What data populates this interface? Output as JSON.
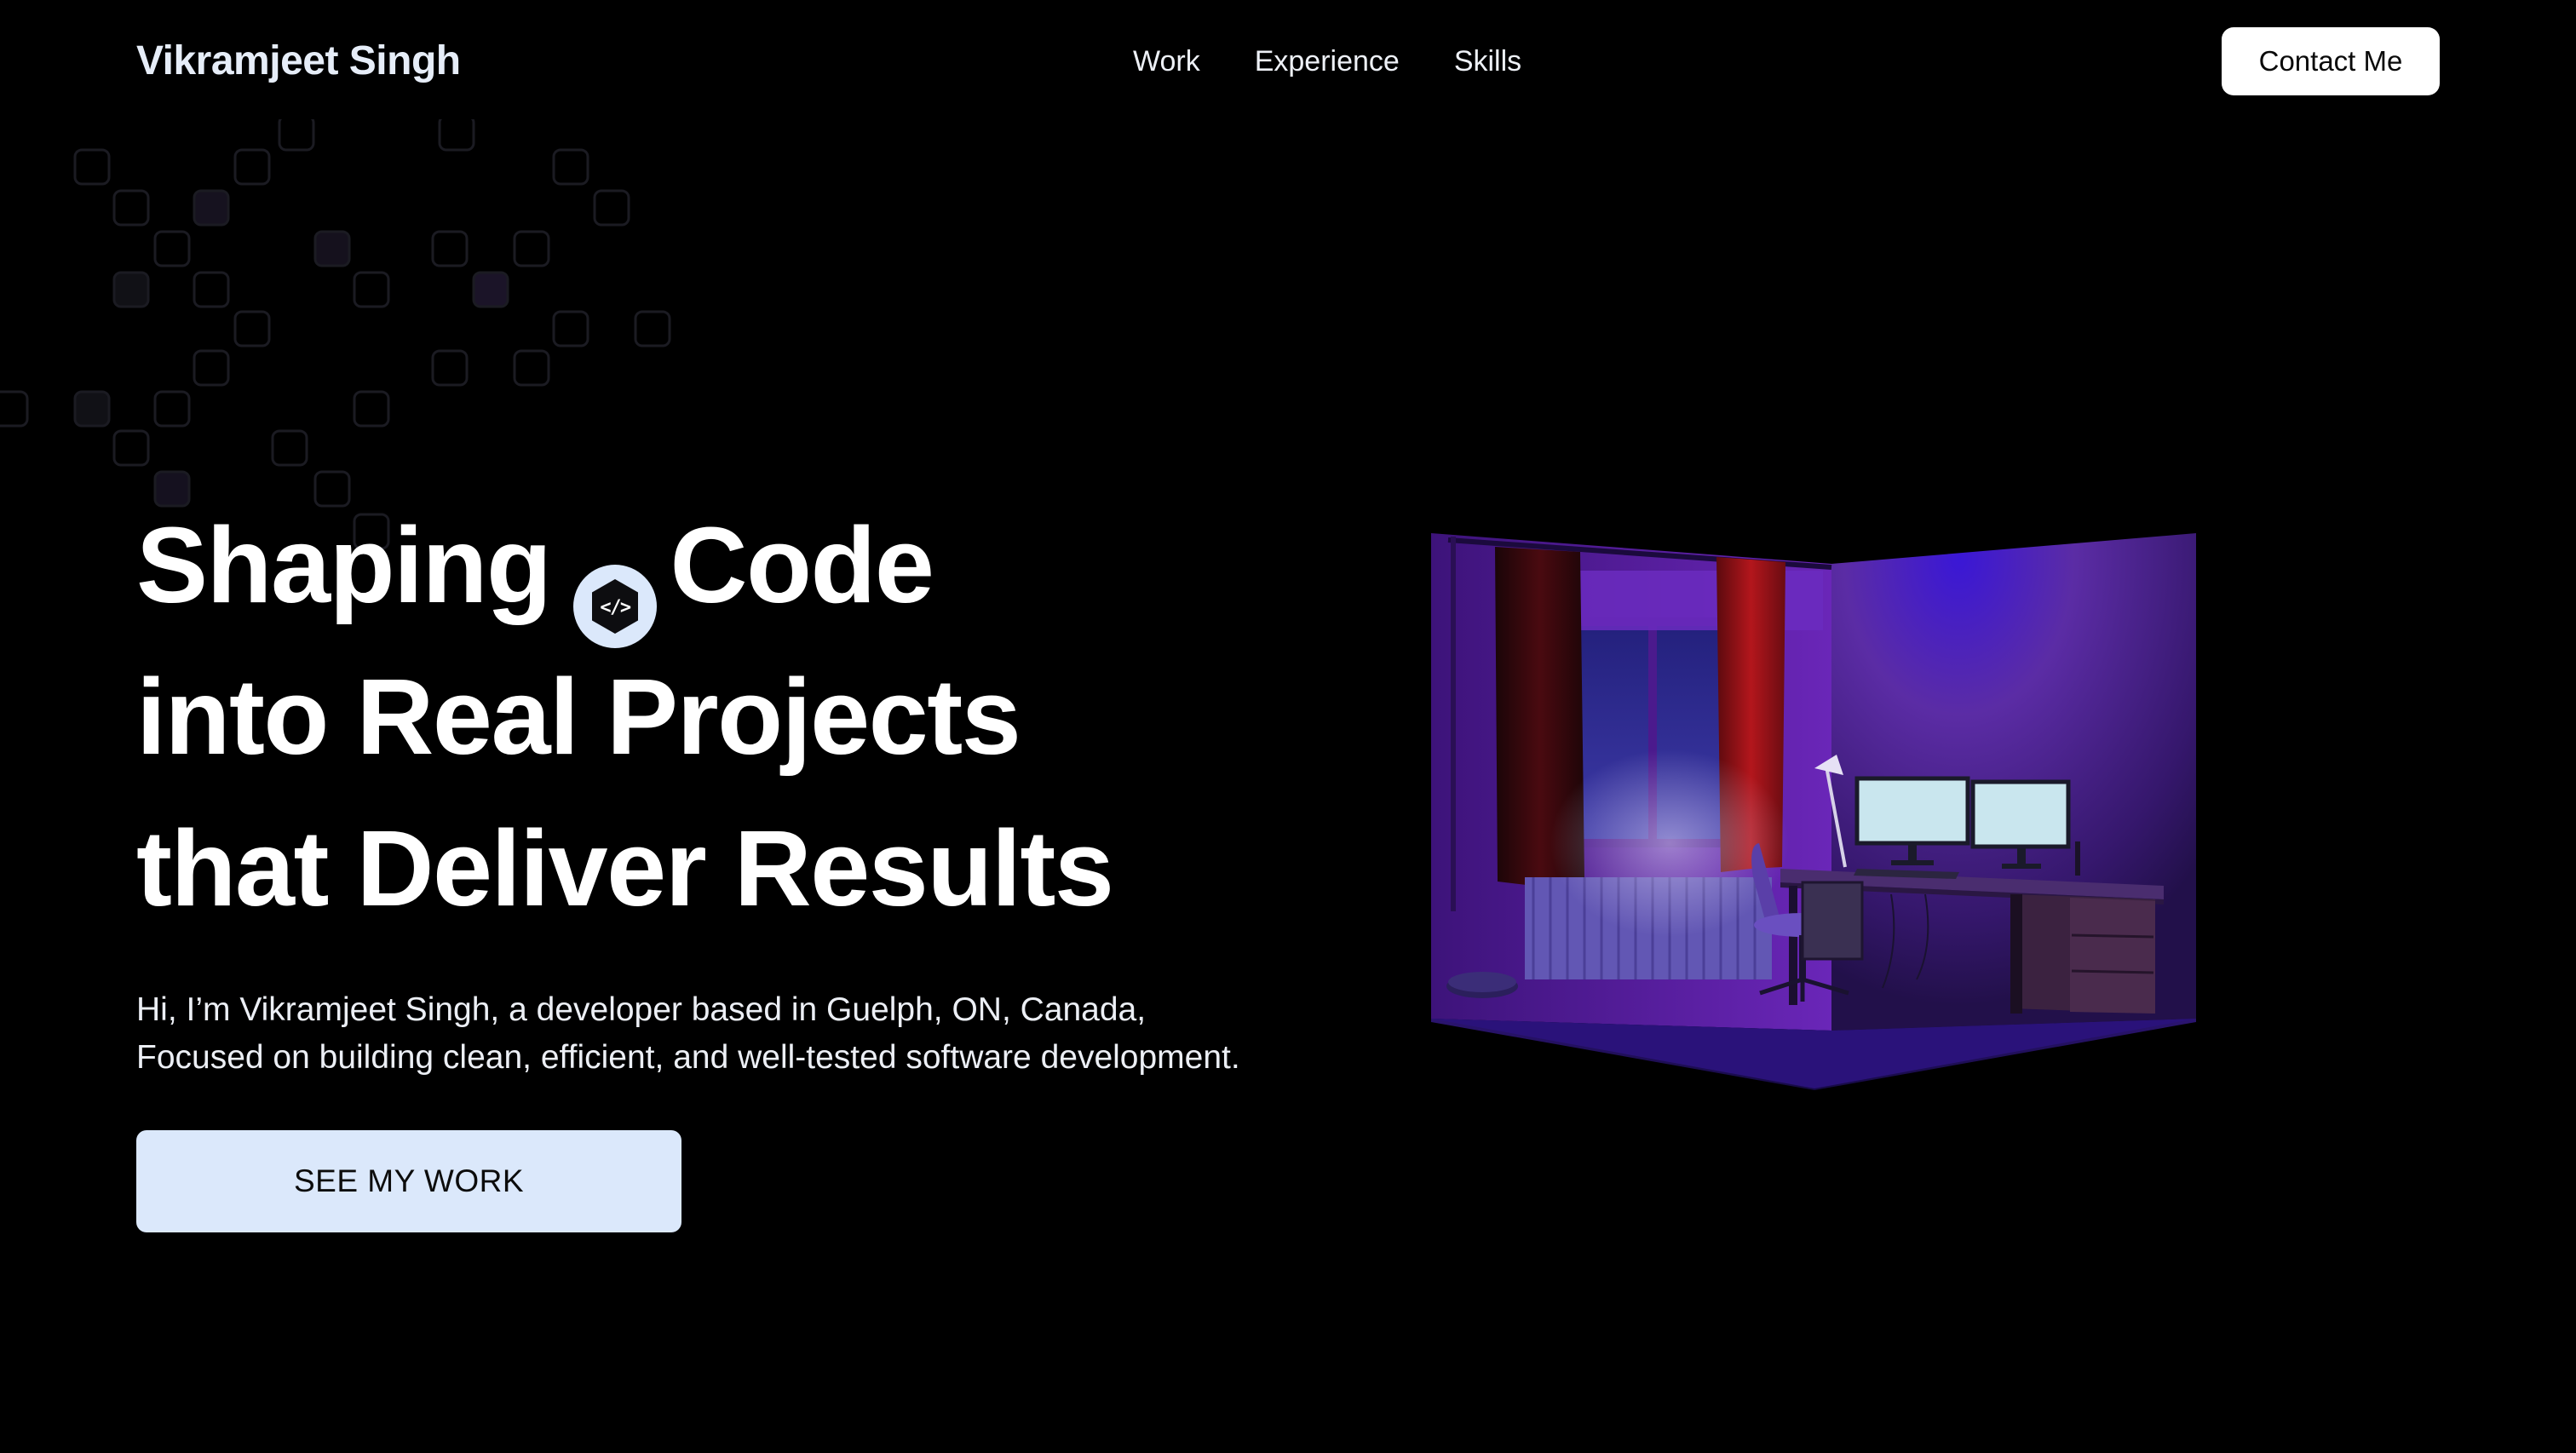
{
  "nav": {
    "logo": "Vikramjeet Singh",
    "links": [
      "Work",
      "Experience",
      "Skills"
    ],
    "contact_label": "Contact Me"
  },
  "hero": {
    "line1_word1": "Shaping",
    "line1_word2": "Code",
    "line2": "into Real Projects",
    "line3": "that Deliver Results",
    "desc_line1": "Hi, I’m Vikramjeet Singh, a developer based in Guelph, ON, Canada,",
    "desc_line2": "Focused on building clean, efficient, and well-tested software development.",
    "cta_label": "SEE MY WORK",
    "badge_icon": "code-icon"
  },
  "colors": {
    "background": "#000000",
    "cta_background": "#dbe8fb",
    "accent_purple": "#6a2fc9",
    "button_white": "#ffffff"
  }
}
